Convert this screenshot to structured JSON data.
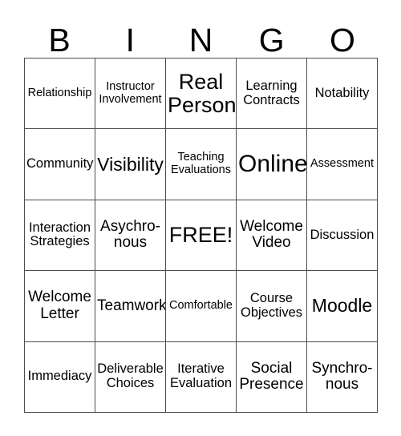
{
  "card": {
    "header_letters": [
      "B",
      "I",
      "N",
      "G",
      "O"
    ],
    "free_space_label": "FREE!",
    "grid": [
      [
        {
          "label": "Relationship",
          "size": "xs",
          "free": false
        },
        {
          "label": "Instructor\nInvolvement",
          "size": "xs",
          "free": false
        },
        {
          "label": "Real\nPerson",
          "size": "xl",
          "free": false
        },
        {
          "label": "Learning\nContracts",
          "size": "sm",
          "free": false
        },
        {
          "label": "Notability",
          "size": "sm",
          "free": false
        }
      ],
      [
        {
          "label": "Community",
          "size": "sm",
          "free": false
        },
        {
          "label": "Visibility",
          "size": "lg",
          "free": false
        },
        {
          "label": "Teaching\nEvaluations",
          "size": "xs",
          "free": false
        },
        {
          "label": "Online",
          "size": "xxl",
          "free": false
        },
        {
          "label": "Assessment",
          "size": "xs",
          "free": false
        }
      ],
      [
        {
          "label": "Interaction\nStrategies",
          "size": "sm",
          "free": false
        },
        {
          "label": "Asychro-\nnous",
          "size": "md",
          "free": false
        },
        {
          "label": "FREE!",
          "size": "xl",
          "free": true
        },
        {
          "label": "Welcome\nVideo",
          "size": "md",
          "free": false
        },
        {
          "label": "Discussion",
          "size": "sm",
          "free": false
        }
      ],
      [
        {
          "label": "Welcome\nLetter",
          "size": "md",
          "free": false
        },
        {
          "label": "Teamwork",
          "size": "md",
          "free": false
        },
        {
          "label": "Comfortable",
          "size": "xs",
          "free": false
        },
        {
          "label": "Course\nObjectives",
          "size": "sm",
          "free": false
        },
        {
          "label": "Moodle",
          "size": "lg",
          "free": false
        }
      ],
      [
        {
          "label": "Immediacy",
          "size": "sm",
          "free": false
        },
        {
          "label": "Deliverable\nChoices",
          "size": "sm",
          "free": false
        },
        {
          "label": "Iterative\nEvaluation",
          "size": "sm",
          "free": false
        },
        {
          "label": "Social\nPresence",
          "size": "md",
          "free": false
        },
        {
          "label": "Synchro-\nnous",
          "size": "md",
          "free": false
        }
      ]
    ]
  },
  "colors": {
    "background": "#ffffff",
    "grid_line": "#4d4d4d",
    "text": "#000000"
  }
}
